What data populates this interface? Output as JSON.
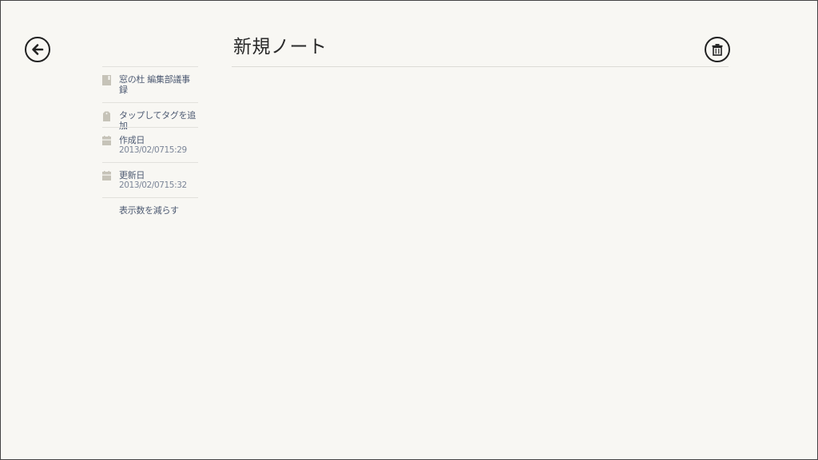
{
  "header": {
    "title": "新規ノート",
    "back_icon": "arrow-left-circle-icon",
    "delete_icon": "trash-icon"
  },
  "sidebar": {
    "notebook": {
      "name": "窓の杜 編集部議事録",
      "icon": "notebook-icon"
    },
    "tags": {
      "label": "タップしてタグを追加",
      "icon": "tag-icon"
    },
    "created": {
      "label": "作成日",
      "value": "2013/02/0715:29",
      "icon": "calendar-icon"
    },
    "updated": {
      "label": "更新日",
      "value": "2013/02/0715:32",
      "icon": "calendar-icon"
    },
    "show_less": {
      "label": "表示数を減らす"
    }
  },
  "colors": {
    "background": "#f8f7f3",
    "text_link": "#4d5a72",
    "text_secondary": "#7c8698",
    "icon_gray": "#c6c3b8",
    "divider": "#e2e1dc"
  }
}
